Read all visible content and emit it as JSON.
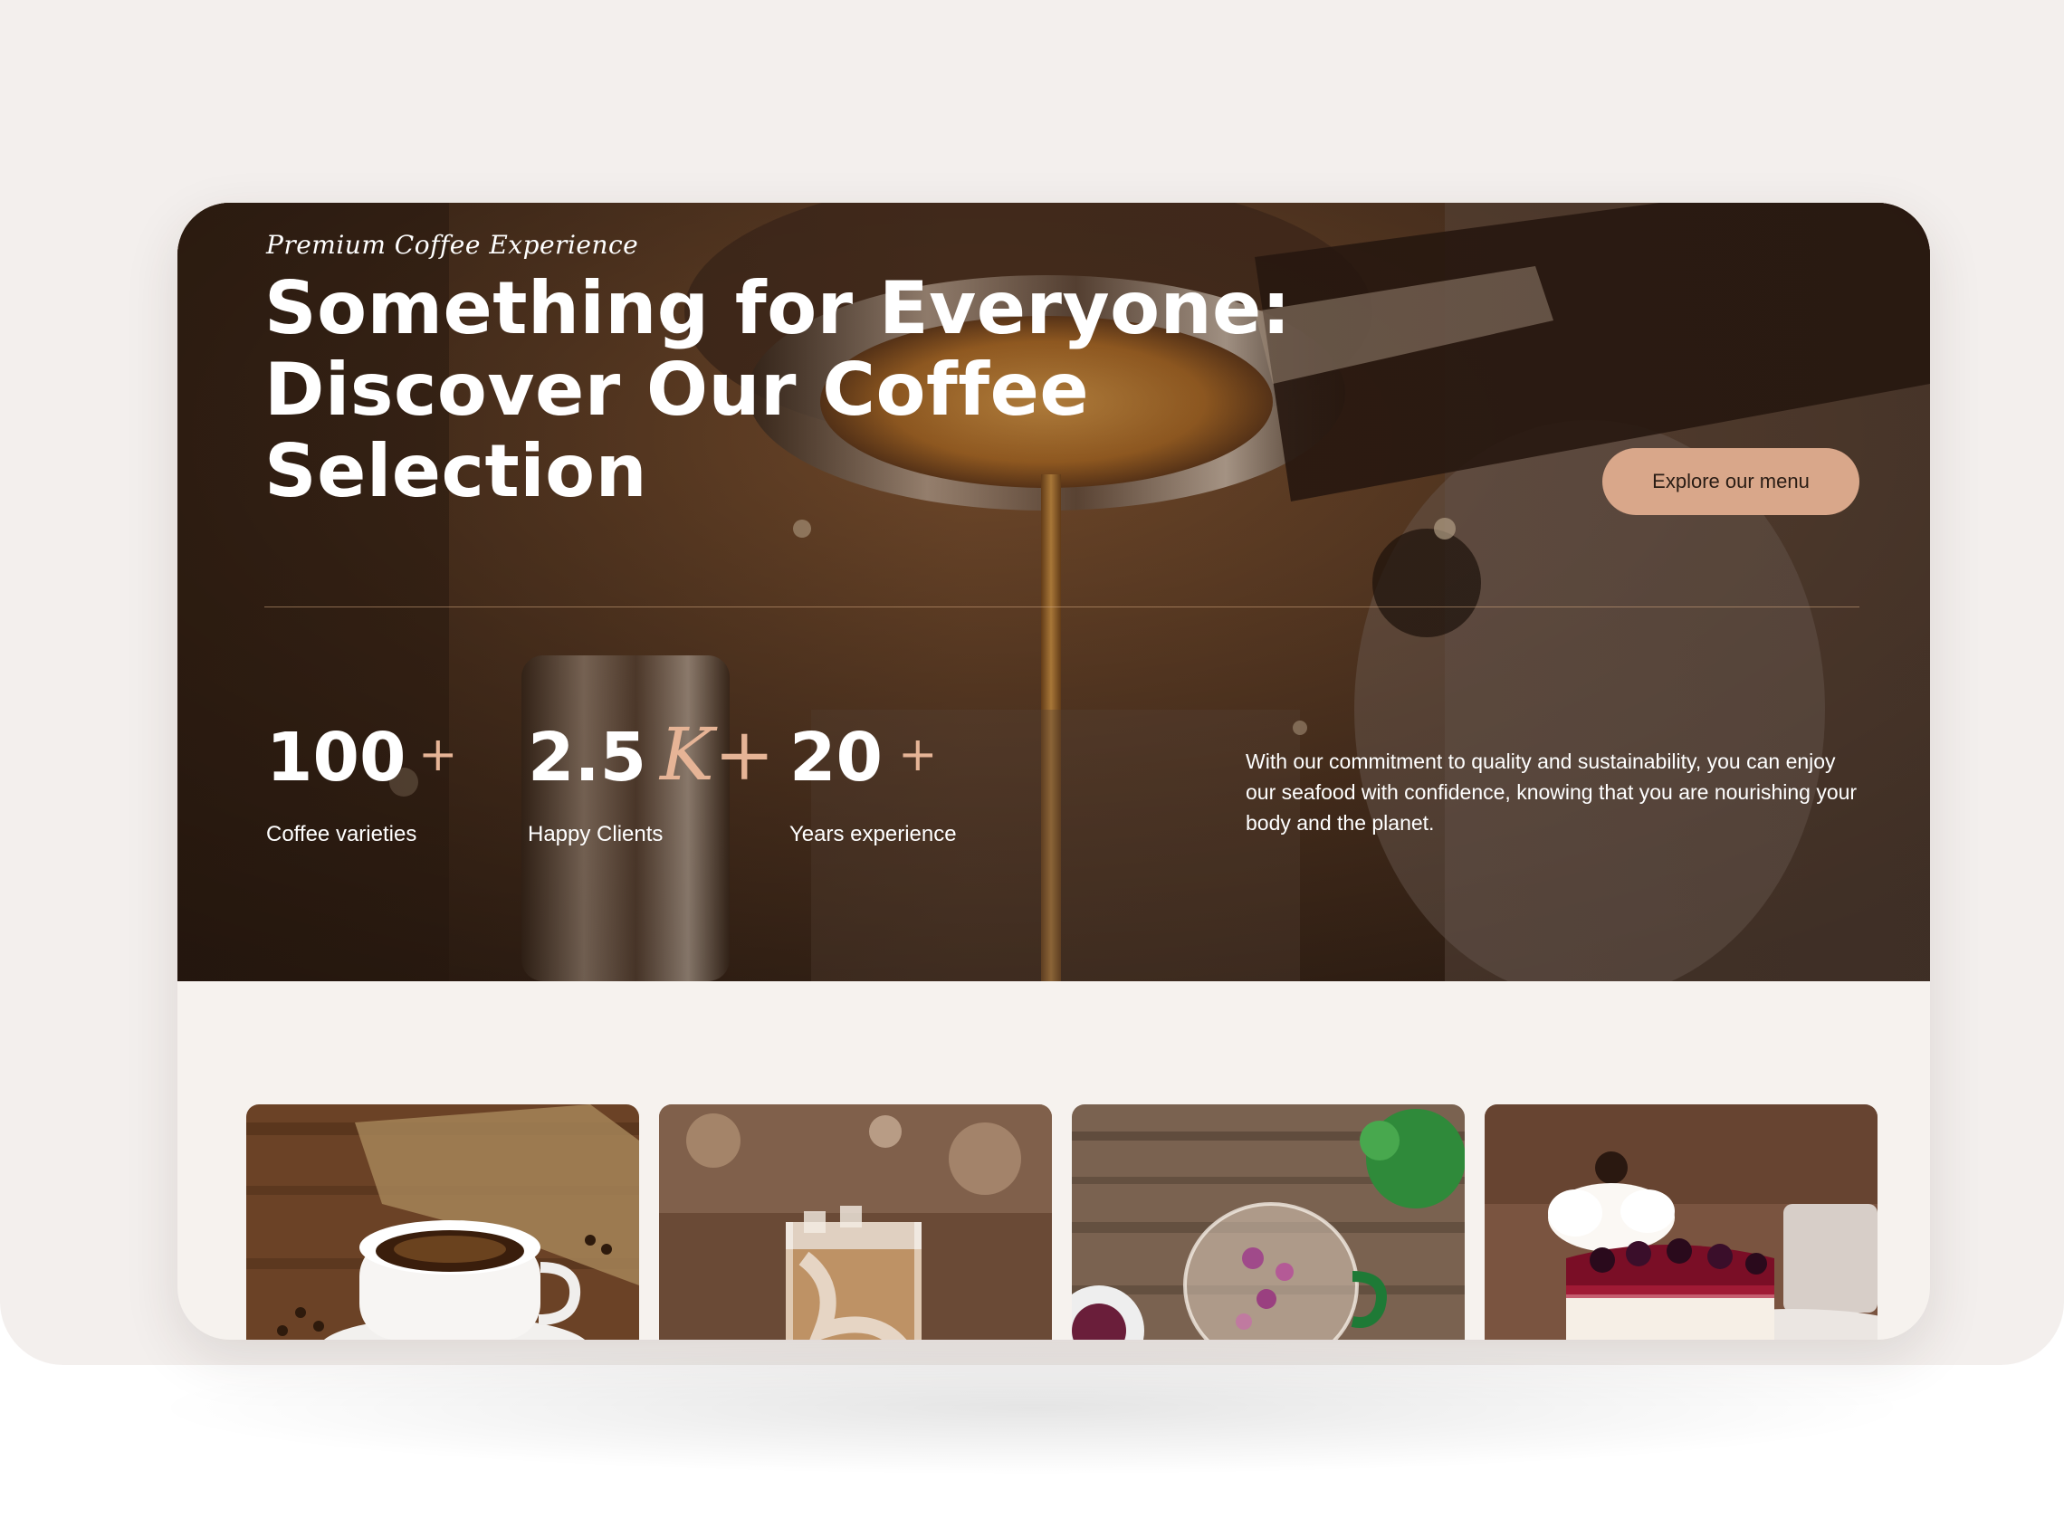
{
  "hero": {
    "eyebrow": "Premium Coffee Experience",
    "headline_lines": [
      "Something for Everyone:",
      "Discover Our Coffee",
      "Selection"
    ],
    "cta_label": "Explore our menu",
    "description": "With our commitment to quality and sustainability, you can enjoy our seafood with confidence, knowing that you are nourishing your body and the planet."
  },
  "stats": [
    {
      "value": "100",
      "suffix": "+",
      "label": "Coffee varieties"
    },
    {
      "value": "2.5",
      "suffix": "K+",
      "label": "Happy Clients"
    },
    {
      "value": "20",
      "suffix": "+",
      "label": "Years experience"
    }
  ],
  "tiles": [
    {
      "image": "espresso-cup-on-burlap-photo"
    },
    {
      "image": "iced-latte-glass-photo"
    },
    {
      "image": "herbal-flower-tea-photo"
    },
    {
      "image": "berry-cheesecake-photo"
    }
  ],
  "colors": {
    "page_background": "#f3efed",
    "card_background": "#f6f2ee",
    "accent": "#d9a78a",
    "suffix": "#e6b496",
    "text_light": "#ffffff",
    "text_dark": "#2a1d15"
  }
}
